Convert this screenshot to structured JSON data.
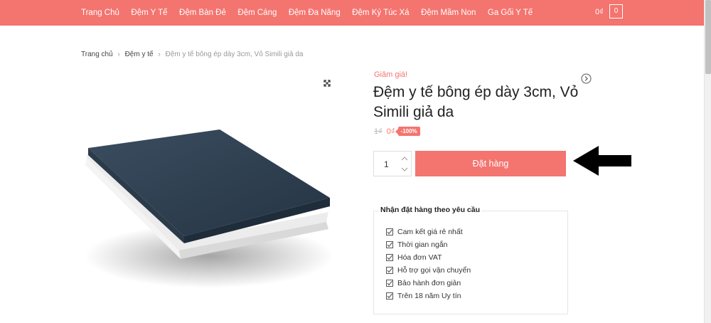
{
  "nav": {
    "items": [
      "Trang Chủ",
      "Đệm Y Tế",
      "Đệm Bàn Đẻ",
      "Đệm Cáng",
      "Đệm Đa Năng",
      "Đệm Ký Túc Xá",
      "Đệm Mầm Non",
      "Ga Gối Y Tế"
    ],
    "cart_total": "0₫",
    "cart_count": "0"
  },
  "breadcrumb": {
    "home": "Trang chủ",
    "category": "Đệm y tế",
    "current": "Đệm y tế bông ép dày 3cm, Vỏ Simili giả da"
  },
  "product": {
    "sale_label": "Giảm giá!",
    "title": "Đệm y tế bông ép dày 3cm, Vỏ Simili giả da",
    "old_price": "1₫",
    "new_price": "0₫",
    "discount": "-100%",
    "quantity": "1",
    "order_button": "Đặt hàng"
  },
  "order_box": {
    "title": "Nhận đặt hàng theo yêu cầu",
    "items": [
      "Cam kết giá rẻ nhất",
      "Thời gian ngắn",
      "Hóa đơn VAT",
      "Hỗ trợ gọi vận chuyển",
      "Bảo hành đơn giản",
      "Trên 18 năm Uy tín"
    ]
  },
  "colors": {
    "accent": "#f4746f",
    "mattress_top": "#2e3f4f",
    "mattress_base": "#ebebeb"
  }
}
